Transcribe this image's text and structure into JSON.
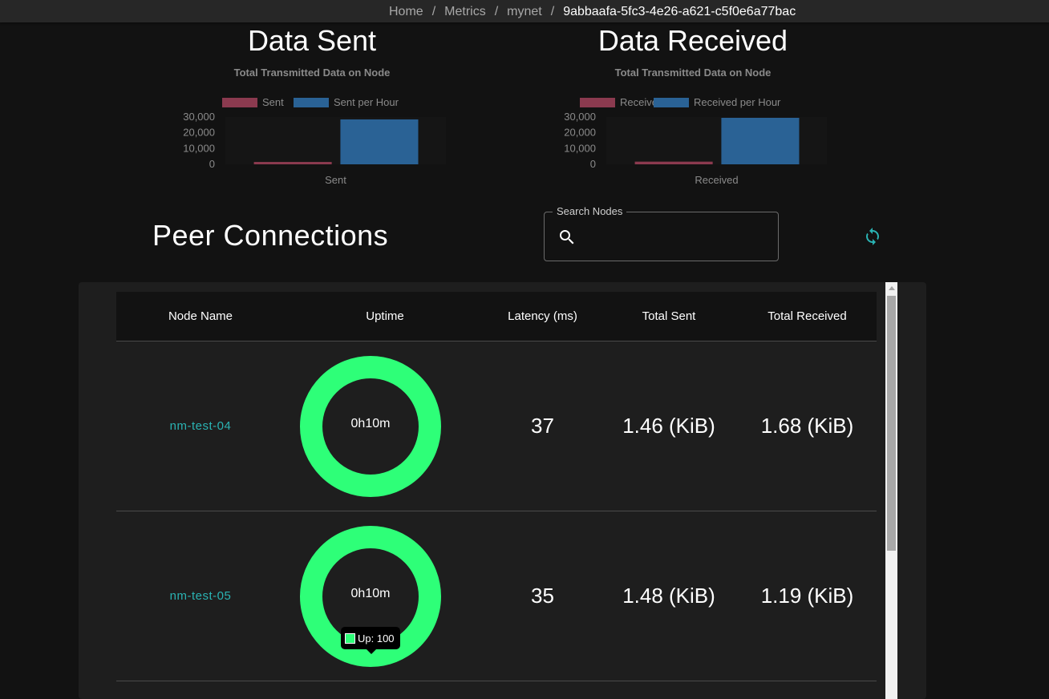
{
  "breadcrumb": {
    "items": [
      "Home",
      "Metrics",
      "mynet",
      "9abbaafa-5fc3-4e26-a621-c5f0e6a77bac"
    ],
    "separator": "/"
  },
  "charts": {
    "sent": {
      "heading": "Data Sent",
      "subtitle": "Total Transmitted Data on Node",
      "legend": [
        "Sent",
        "Sent per Hour"
      ],
      "xlabel": "Sent",
      "yticks": [
        "30,000",
        "20,000",
        "10,000",
        "0"
      ]
    },
    "received": {
      "heading": "Data Received",
      "subtitle": "Total Transmitted Data on Node",
      "legend": [
        "Received",
        "Received per Hour"
      ],
      "xlabel": "Received",
      "yticks": [
        "30,000",
        "20,000",
        "10,000",
        "0"
      ]
    }
  },
  "chart_data": [
    {
      "type": "bar",
      "title": "Total Transmitted Data on Node",
      "categories": [
        "Sent"
      ],
      "series": [
        {
          "name": "Sent",
          "values": [
            1500
          ],
          "color": "#8b3a4f"
        },
        {
          "name": "Sent per Hour",
          "values": [
            28500
          ],
          "color": "#2a6295"
        }
      ],
      "xlabel": "Sent",
      "ylabel": "",
      "ylim": [
        0,
        30000
      ],
      "yticks": [
        0,
        10000,
        20000,
        30000
      ],
      "legend": "top",
      "grid": false
    },
    {
      "type": "bar",
      "title": "Total Transmitted Data on Node",
      "categories": [
        "Received"
      ],
      "series": [
        {
          "name": "Received",
          "values": [
            1700
          ],
          "color": "#8b3a4f"
        },
        {
          "name": "Received per Hour",
          "values": [
            29500
          ],
          "color": "#2a6295"
        }
      ],
      "xlabel": "Received",
      "ylabel": "",
      "ylim": [
        0,
        30000
      ],
      "yticks": [
        0,
        10000,
        20000,
        30000
      ],
      "legend": "top",
      "grid": false
    }
  ],
  "peers": {
    "title": "Peer Connections",
    "search": {
      "legend": "Search Nodes",
      "value": "",
      "placeholder": ""
    },
    "columns": [
      "Node Name",
      "Uptime",
      "Latency (ms)",
      "Total Sent",
      "Total Received"
    ],
    "rows": [
      {
        "name": "nm-test-04",
        "uptime": "0h10m",
        "uptime_percent": 100,
        "latency": "37",
        "sent": "1.46 (KiB)",
        "received": "1.68 (KiB)"
      },
      {
        "name": "nm-test-05",
        "uptime": "0h10m",
        "uptime_percent": 100,
        "latency": "35",
        "sent": "1.48 (KiB)",
        "received": "1.19 (KiB)"
      }
    ],
    "tooltip": "Up: 100"
  },
  "colors": {
    "accent": "#2ab3b3",
    "uptime": "#2eff78",
    "sent_bar": "#8b3a4f",
    "per_hour_bar": "#2a6295"
  },
  "icons": {
    "search": "search-icon",
    "refresh": "refresh-icon"
  }
}
